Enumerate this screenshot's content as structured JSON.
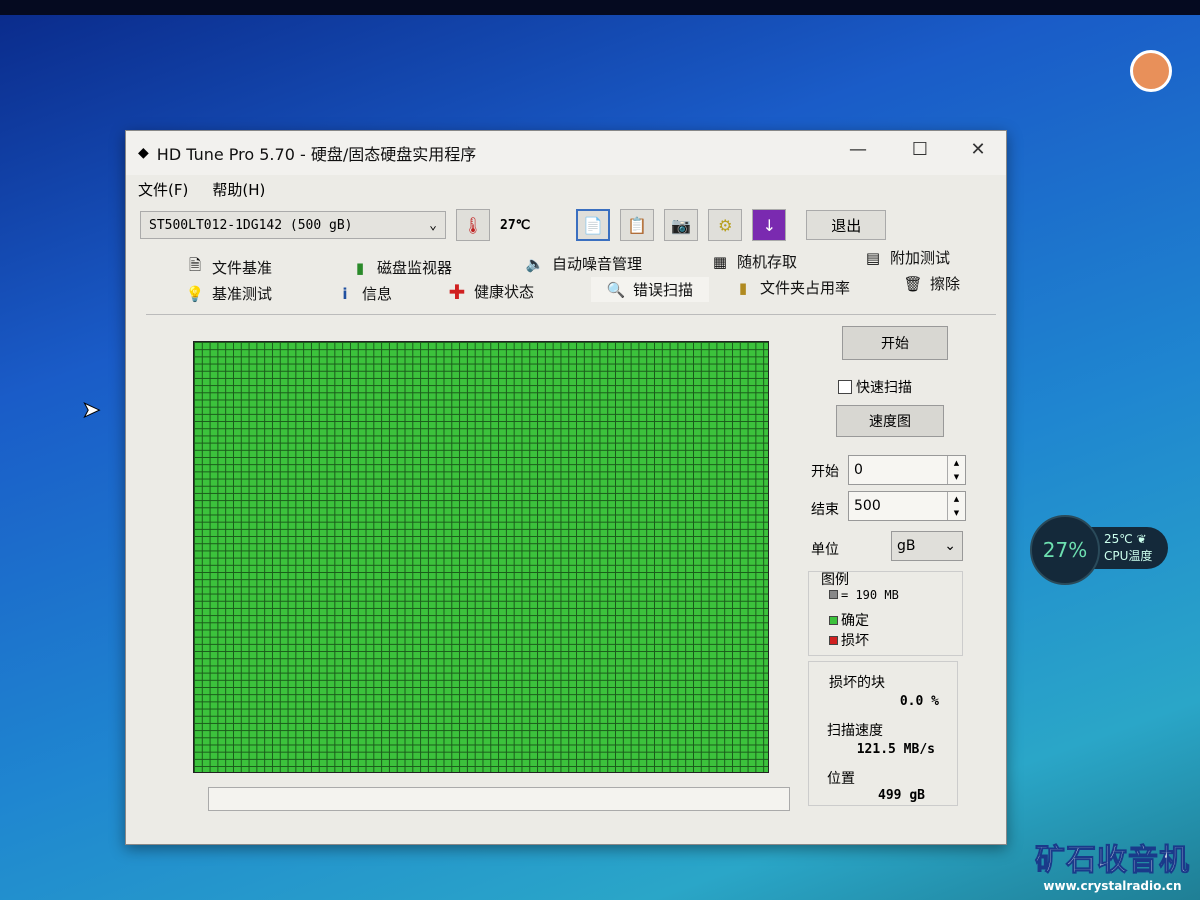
{
  "window": {
    "title": "HD Tune Pro 5.70 - 硬盘/固态硬盘实用程序",
    "minimize": "—",
    "maximize": "☐",
    "close": "✕"
  },
  "menu": [
    "文件(F)",
    "帮助(H)"
  ],
  "toolbar": {
    "drive": "ST500LT012-1DG142 (500 gB)",
    "temperature": "27℃",
    "exit": "退出"
  },
  "tabs_row1": [
    {
      "label": "文件基准",
      "icon": "file-benchmark-icon"
    },
    {
      "label": "磁盘监视器",
      "icon": "disk-monitor-icon"
    },
    {
      "label": "自动噪音管理",
      "icon": "speaker-icon"
    },
    {
      "label": "随机存取",
      "icon": "random-access-icon"
    },
    {
      "label": "附加测试",
      "icon": "extra-tests-icon"
    }
  ],
  "tabs_row2": [
    {
      "label": "基准测试",
      "icon": "benchmark-icon"
    },
    {
      "label": "信息",
      "icon": "info-icon"
    },
    {
      "label": "健康状态",
      "icon": "health-icon"
    },
    {
      "label": "错误扫描",
      "icon": "magnifier-icon",
      "active": true
    },
    {
      "label": "文件夹占用率",
      "icon": "folder-icon"
    },
    {
      "label": "擦除",
      "icon": "trash-icon"
    }
  ],
  "scan": {
    "start_button": "开始",
    "quick_scan": "快速扫描",
    "quick_scan_checked": false,
    "speed_map": "速度图",
    "start_label": "开始",
    "start_value": "0",
    "end_label": "结束",
    "end_value": "500",
    "unit_label": "单位",
    "unit_value": "gB",
    "legend": {
      "title": "图例",
      "block": "= 190 MB",
      "ok": "确定",
      "damaged": "损坏"
    },
    "damaged_blocks_label": "损坏的块",
    "damaged_blocks_value": "0.0 %",
    "scan_speed_label": "扫描速度",
    "scan_speed_value": "121.5 MB/s",
    "position_label": "位置",
    "position_value": "499 gB",
    "colors": {
      "ok": "#3cc23c",
      "damaged": "#d02020",
      "block": "#888888"
    }
  },
  "desktop": {
    "cpu_load": "27%",
    "cpu_temp": "25℃",
    "cpu_label": "CPU温度",
    "watermark": "矿石收音机",
    "watermark_url": "www.crystalradio.cn"
  }
}
